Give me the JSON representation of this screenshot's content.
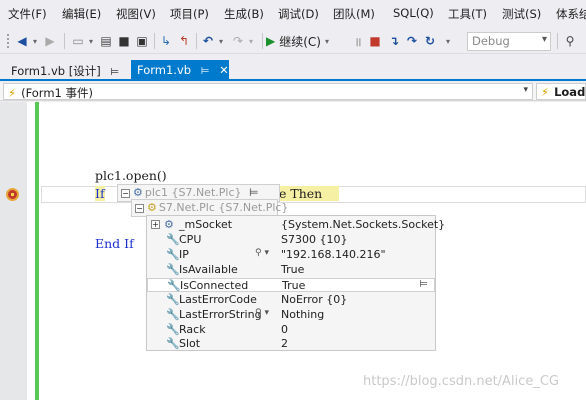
{
  "menu": [
    "文件(F)",
    "编辑(E)",
    "视图(V)",
    "项目(P)",
    "生成(B)",
    "调试(D)",
    "团队(M)",
    "SQL(Q)",
    "工具(T)",
    "测试(S)",
    "体系结"
  ],
  "toolbar": {
    "continue_label": "继续(C)",
    "config_value": "Debug"
  },
  "tabs": [
    {
      "label": "Form1.vb [设计]",
      "pin": "⊨"
    },
    {
      "label": "Form1.vb",
      "pin": "⊨",
      "close": "✕"
    }
  ],
  "nav": {
    "left": "(Form1 事件)",
    "right": "Load"
  },
  "code": {
    "line1": "plc1.open()",
    "if_kw": "If",
    "then_frag": "e Then",
    "end_if": "End If"
  },
  "tooltip": {
    "var": "plc1",
    "var_type": "{S7.Net.Plc}",
    "inner_var": "S7.Net.Plc",
    "inner_type": "{S7.Net.Plc}",
    "properties": [
      {
        "name": "_mSocket",
        "value": "{System.Net.Sockets.Socket}",
        "icon": "object-icon",
        "expand": "⊞"
      },
      {
        "name": "CPU",
        "value": "S7300 {10}",
        "icon": "wrench-icon"
      },
      {
        "name": "IP",
        "value": "\"192.168.140.216\"",
        "icon": "wrench-icon",
        "search": "🔍 ▾"
      },
      {
        "name": "IsAvailable",
        "value": "True",
        "icon": "wrench-icon"
      },
      {
        "name": "IsConnected",
        "value": "True",
        "icon": "wrench-icon"
      },
      {
        "name": "LastErrorCode",
        "value": "NoError {0}",
        "icon": "wrench-icon"
      },
      {
        "name": "LastErrorString",
        "value": "Nothing",
        "icon": "wrench-icon",
        "search": "🔍 ▾"
      },
      {
        "name": "Rack",
        "value": "0",
        "icon": "wrench-icon"
      },
      {
        "name": "Slot",
        "value": "2",
        "icon": "wrench-icon"
      }
    ]
  },
  "watermark": "https://blog.csdn.net/Alice_CG"
}
